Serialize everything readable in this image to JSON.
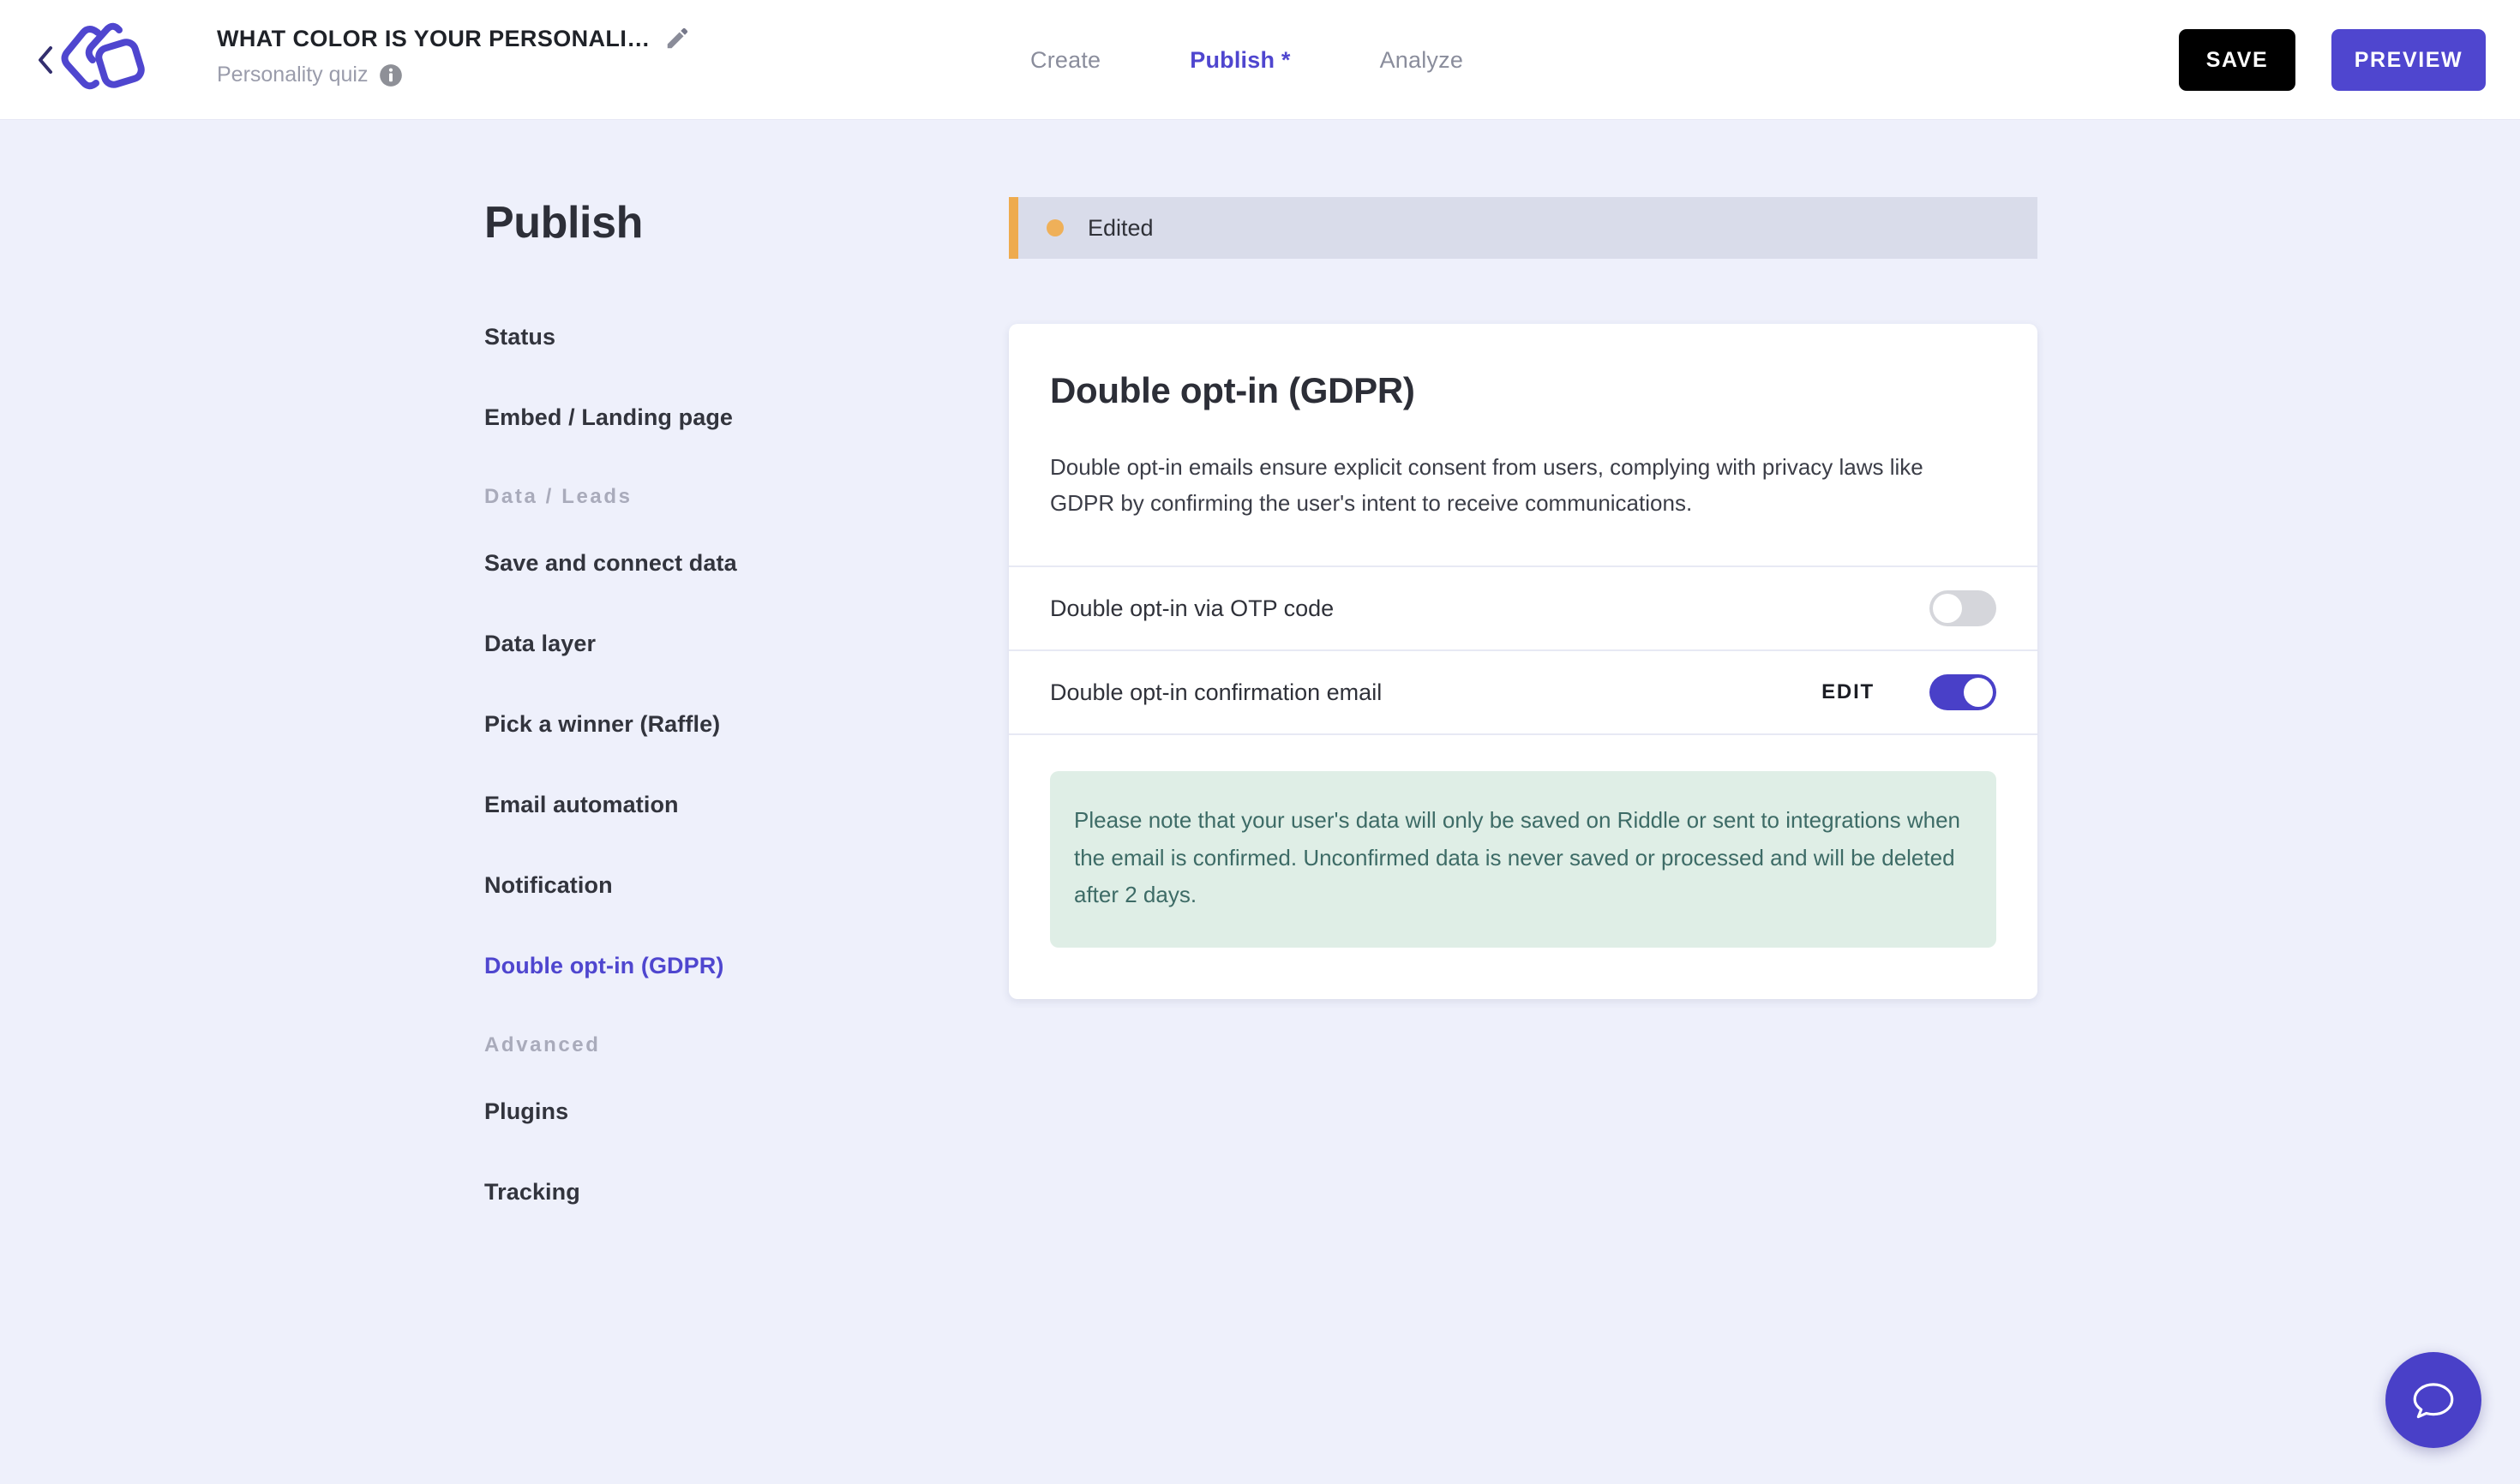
{
  "header": {
    "back_icon": "chevron-left-icon",
    "logo_icon": "riddle-logo",
    "quiz_title": "WHAT COLOR IS YOUR PERSONALI…",
    "edit_title_icon": "pencil-icon",
    "quiz_type": "Personality quiz",
    "info_icon": "info-icon",
    "tabs": [
      {
        "label": "Create",
        "active": false
      },
      {
        "label": "Publish *",
        "active": true
      },
      {
        "label": "Analyze",
        "active": false
      }
    ],
    "save_label": "SAVE",
    "preview_label": "PREVIEW"
  },
  "sidebar": {
    "heading": "Publish",
    "items": [
      {
        "label": "Status",
        "active": false
      },
      {
        "label": "Embed / Landing page",
        "active": false
      }
    ],
    "group_data_label": "Data / Leads",
    "data_items": [
      {
        "label": "Save and connect data",
        "active": false
      },
      {
        "label": "Data layer",
        "active": false
      },
      {
        "label": "Pick a winner (Raffle)",
        "active": false
      },
      {
        "label": "Email automation",
        "active": false
      },
      {
        "label": "Notification",
        "active": false
      },
      {
        "label": "Double opt-in (GDPR)",
        "active": true
      }
    ],
    "group_advanced_label": "Advanced",
    "advanced_items": [
      {
        "label": "Plugins",
        "active": false
      },
      {
        "label": "Tracking",
        "active": false
      }
    ]
  },
  "main": {
    "status_banner": {
      "text": "Edited",
      "dot_color": "#efb059",
      "bar_color": "#eeab4e",
      "bg_color": "#d9dcea"
    },
    "card": {
      "title": "Double opt-in (GDPR)",
      "description": "Double opt-in emails ensure explicit consent from users, complying with privacy laws like GDPR by confirming the user's intent to receive communications.",
      "rows": [
        {
          "label": "Double opt-in via OTP code",
          "edit_label": "",
          "toggle_on": false
        },
        {
          "label": "Double opt-in confirmation email",
          "edit_label": "EDIT",
          "toggle_on": true
        }
      ],
      "note": "Please note that your user's data will only be saved on Riddle or sent to integrations when the email is confirmed. Unconfirmed data is never saved or processed and will be deleted after 2 days.",
      "note_bg": "#dfeee6",
      "note_color": "#3d6b66"
    }
  },
  "chat": {
    "icon": "chat-bubble-icon",
    "color": "#4940c8"
  },
  "theme": {
    "accent": "#4f46cf",
    "page_bg": "#eef0fb",
    "card_bg": "#ffffff"
  }
}
